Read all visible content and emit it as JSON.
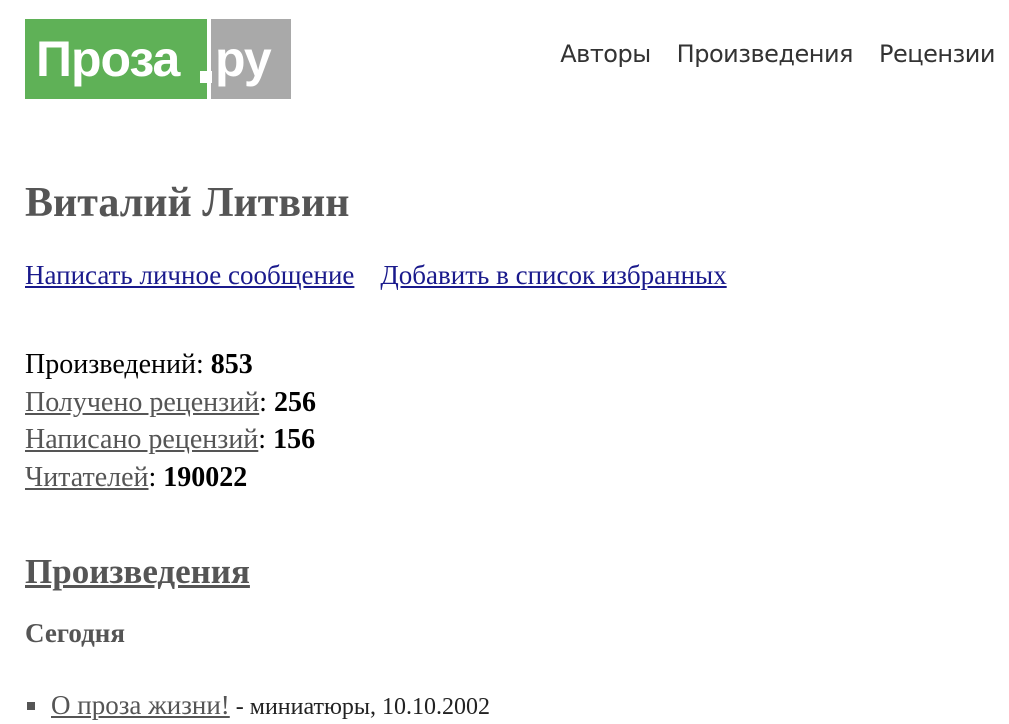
{
  "header": {
    "logo": {
      "main": "Проза",
      "tld": "ру"
    },
    "nav": [
      {
        "label": "Авторы"
      },
      {
        "label": "Произведения"
      },
      {
        "label": "Рецензии"
      }
    ]
  },
  "author": {
    "name": "Виталий Литвин",
    "actions": {
      "message": "Написать личное сообщение",
      "favorite": "Добавить в список избранных"
    },
    "stats": {
      "works_label": "Произведений",
      "works_value": "853",
      "received_label": "Получено рецензий",
      "received_value": "256",
      "written_label": "Написано рецензий",
      "written_value": "156",
      "readers_label": "Читателей",
      "readers_value": "190022"
    }
  },
  "works_section": {
    "title": "Произведения",
    "group": "Сегодня",
    "items": [
      {
        "title": "О проза жизни!",
        "meta": " - миниатюры, 10.10.2002"
      }
    ]
  },
  "colors": {
    "logo_green": "#5fb157",
    "logo_gray": "#a9a9a9",
    "link_blue": "#1a1a8c",
    "heading_gray": "#555555"
  }
}
